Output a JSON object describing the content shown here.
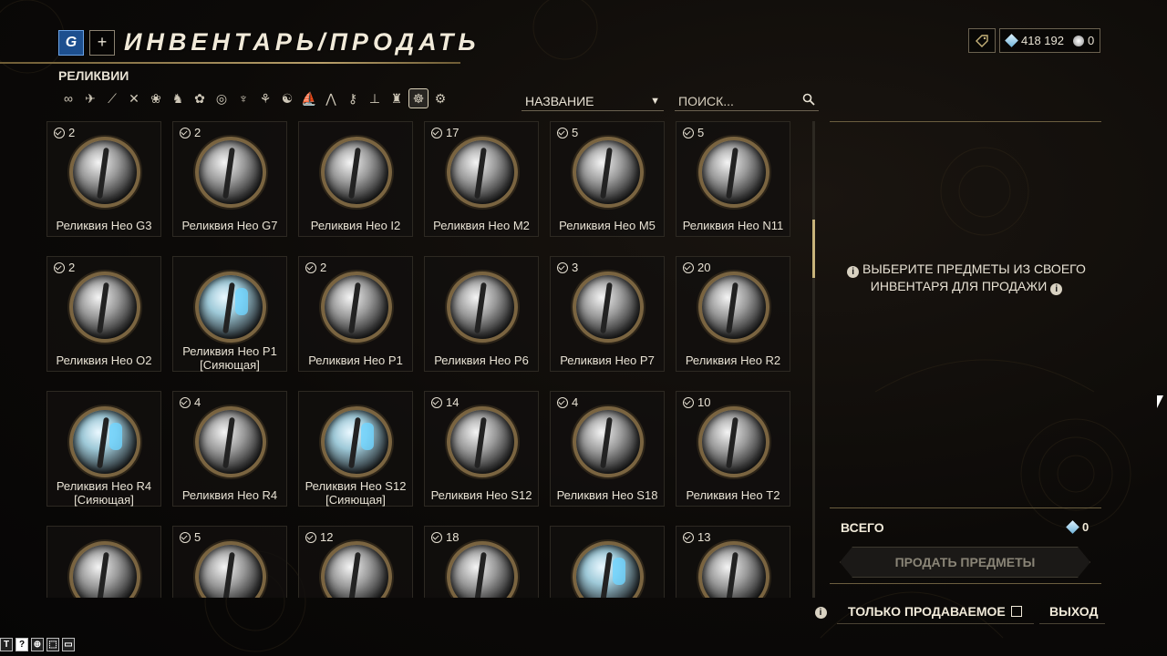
{
  "header": {
    "logo_label": "G",
    "plus_label": "+",
    "title": "ИНВЕНТАРЬ/ПРОДАТЬ"
  },
  "currency": {
    "platinum": "418 192",
    "credits": "0"
  },
  "category": "РЕЛИКВИИ",
  "filters": [
    {
      "name": "all-filter",
      "glyph": "∞"
    },
    {
      "name": "warframe-filter",
      "glyph": "✈"
    },
    {
      "name": "primary-filter",
      "glyph": "⟋"
    },
    {
      "name": "secondary-filter",
      "glyph": "✕"
    },
    {
      "name": "melee-filter",
      "glyph": "❀"
    },
    {
      "name": "archwing-filter",
      "glyph": "♞"
    },
    {
      "name": "companion-filter",
      "glyph": "✿"
    },
    {
      "name": "sentinel-filter",
      "glyph": "◎"
    },
    {
      "name": "mod-filter",
      "glyph": "♆"
    },
    {
      "name": "arcane-filter",
      "glyph": "⚘"
    },
    {
      "name": "kubrow-filter",
      "glyph": "☯"
    },
    {
      "name": "ship-filter",
      "glyph": "⛵"
    },
    {
      "name": "fish-filter",
      "glyph": "⋀"
    },
    {
      "name": "key-filter",
      "glyph": "⚷"
    },
    {
      "name": "gear-filter",
      "glyph": "⊥"
    },
    {
      "name": "resource-filter",
      "glyph": "♜"
    },
    {
      "name": "relic-filter",
      "glyph": "☸",
      "active": true
    },
    {
      "name": "misc-filter",
      "glyph": "⚙"
    }
  ],
  "sort": {
    "label": "НАЗВАНИЕ"
  },
  "search": {
    "placeholder": "ПОИСК..."
  },
  "items": [
    {
      "count": "2",
      "name": "Реликвия Нео G3",
      "sub": ""
    },
    {
      "count": "2",
      "name": "Реликвия Нео G7",
      "sub": ""
    },
    {
      "count": "",
      "name": "Реликвия Нео I2",
      "sub": ""
    },
    {
      "count": "17",
      "name": "Реликвия Нео M2",
      "sub": ""
    },
    {
      "count": "5",
      "name": "Реликвия Нео M5",
      "sub": ""
    },
    {
      "count": "5",
      "name": "Реликвия Нео N11",
      "sub": ""
    },
    {
      "count": "2",
      "name": "Реликвия Нео O2",
      "sub": ""
    },
    {
      "count": "",
      "name": "Реликвия Нео P1",
      "sub": "[Сияющая]",
      "radiant": true
    },
    {
      "count": "2",
      "name": "Реликвия Нео P1",
      "sub": ""
    },
    {
      "count": "",
      "name": "Реликвия Нео P6",
      "sub": ""
    },
    {
      "count": "3",
      "name": "Реликвия Нео P7",
      "sub": ""
    },
    {
      "count": "20",
      "name": "Реликвия Нео R2",
      "sub": ""
    },
    {
      "count": "",
      "name": "Реликвия Нео R4",
      "sub": "[Сияющая]",
      "radiant": true
    },
    {
      "count": "4",
      "name": "Реликвия Нео R4",
      "sub": ""
    },
    {
      "count": "",
      "name": "Реликвия Нео S12",
      "sub": "[Сияющая]",
      "radiant": true
    },
    {
      "count": "14",
      "name": "Реликвия Нео S12",
      "sub": ""
    },
    {
      "count": "4",
      "name": "Реликвия Нео S18",
      "sub": ""
    },
    {
      "count": "10",
      "name": "Реликвия Нео T2",
      "sub": ""
    },
    {
      "count": "",
      "name": "",
      "sub": ""
    },
    {
      "count": "5",
      "name": "",
      "sub": ""
    },
    {
      "count": "12",
      "name": "",
      "sub": ""
    },
    {
      "count": "18",
      "name": "",
      "sub": ""
    },
    {
      "count": "",
      "name": "",
      "sub": "",
      "radiant": true
    },
    {
      "count": "13",
      "name": "",
      "sub": ""
    }
  ],
  "panel": {
    "hint_line1": "ВЫБЕРИТЕ ПРЕДМЕТЫ ИЗ СВОЕГО",
    "hint_line2": "ИНВЕНТАРЯ ДЛЯ ПРОДАЖИ",
    "total_label": "ВСЕГО",
    "total_value": "0",
    "sell_button": "ПРОДАТЬ ПРЕДМЕТЫ"
  },
  "footer": {
    "only_sellable": "ТОЛЬКО ПРОДАВАЕМОЕ",
    "exit": "ВЫХОД",
    "info": "i"
  },
  "mini_buttons": [
    "T",
    "?",
    "⊕",
    "⬚",
    "▭"
  ],
  "colors": {
    "accent_gold": "#c7b37a",
    "platinum_blue": "#6fb3d9",
    "tile_border": "#2d2922"
  }
}
